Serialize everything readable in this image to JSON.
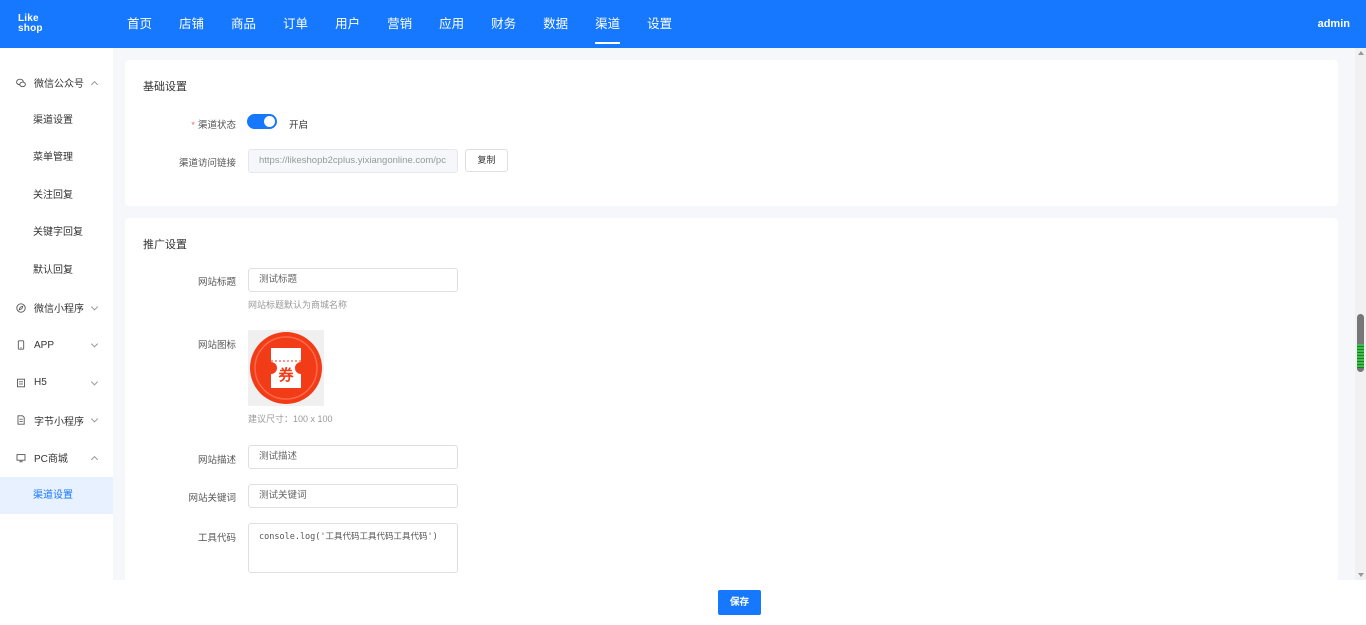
{
  "brand": {
    "logo_line1": "Like",
    "logo_line2": "shop",
    "accent": "#1677ff"
  },
  "topnav": {
    "items": [
      "首页",
      "店铺",
      "商品",
      "订单",
      "用户",
      "营销",
      "应用",
      "财务",
      "数据",
      "渠道",
      "设置"
    ],
    "active": "渠道",
    "user": "admin"
  },
  "sidebar": {
    "wechat_oa": "微信公众号",
    "oa_items": [
      "渠道设置",
      "菜单管理",
      "关注回复",
      "关键字回复",
      "默认回复"
    ],
    "mini_program": "微信小程序",
    "app": "APP",
    "h5": "H5",
    "bytedance": "字节小程序",
    "pc_mall": "PC商城",
    "pc_items": [
      "渠道设置"
    ]
  },
  "basic": {
    "title": "基础设置",
    "status_label": "渠道状态",
    "status_text": "开启",
    "status_on": true,
    "link_label": "渠道访问链接",
    "link_value": "https://likeshopb2cplus.yixiangonline.com/pc",
    "copy_label": "复制"
  },
  "promo": {
    "title": "推广设置",
    "site_title_label": "网站标题",
    "site_title_value": "测试标题",
    "site_title_hint": "网站标题默认为商城名称",
    "site_icon_label": "网站图标",
    "site_icon_glyph": "券",
    "site_icon_hint": "建议尺寸：100 x 100",
    "desc_label": "网站描述",
    "desc_value": "测试描述",
    "keywords_label": "网站关键词",
    "keywords_value": "测试关键词",
    "tool_code_label": "工具代码",
    "tool_code_value": "console.log('工具代码工具代码工具代码')"
  },
  "footer": {
    "save_label": "保存"
  }
}
